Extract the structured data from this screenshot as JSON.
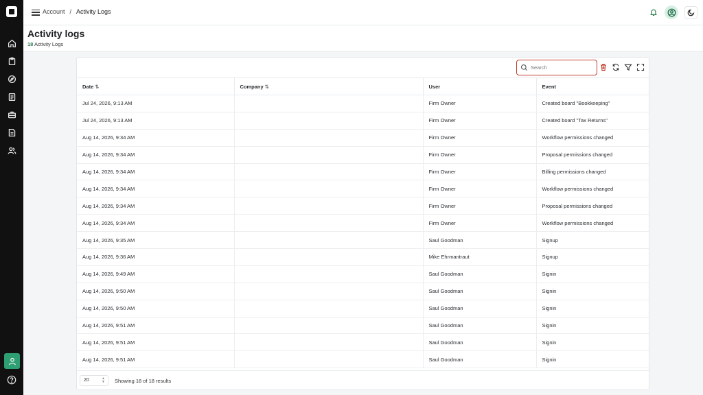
{
  "header": {
    "breadcrumb": [
      "Account",
      "Activity Logs"
    ],
    "breadcrumb_sep": "/"
  },
  "page": {
    "title": "Activity logs",
    "count": "18",
    "count_label": "Activity Logs"
  },
  "search": {
    "placeholder": "Search"
  },
  "table": {
    "columns": [
      "Date",
      "Company",
      "User",
      "Event"
    ],
    "sort_glyph": "⇅",
    "rows": [
      [
        "Jul 24, 2026, 9:13 AM",
        "",
        "Firm Owner",
        "Created board \"Bookkeeping\""
      ],
      [
        "Jul 24, 2026, 9:13 AM",
        "",
        "Firm Owner",
        "Created board \"Tax Returns\""
      ],
      [
        "Aug 14, 2026, 9:34 AM",
        "",
        "Firm Owner",
        "Workflow permissions changed"
      ],
      [
        "Aug 14, 2026, 9:34 AM",
        "",
        "Firm Owner",
        "Proposal permissions changed"
      ],
      [
        "Aug 14, 2026, 9:34 AM",
        "",
        "Firm Owner",
        "Billing permissions changed"
      ],
      [
        "Aug 14, 2026, 9:34 AM",
        "",
        "Firm Owner",
        "Workflow permissions changed"
      ],
      [
        "Aug 14, 2026, 9:34 AM",
        "",
        "Firm Owner",
        "Proposal permissions changed"
      ],
      [
        "Aug 14, 2026, 9:34 AM",
        "",
        "Firm Owner",
        "Workflow permissions changed"
      ],
      [
        "Aug 14, 2026, 9:35 AM",
        "",
        "Saul Goodman",
        "Signup"
      ],
      [
        "Aug 14, 2026, 9:36 AM",
        "",
        "Mike Ehrmantraut",
        "Signup"
      ],
      [
        "Aug 14, 2026, 9:49 AM",
        "",
        "Saul Goodman",
        "Signin"
      ],
      [
        "Aug 14, 2026, 9:50 AM",
        "",
        "Saul Goodman",
        "Signin"
      ],
      [
        "Aug 14, 2026, 9:50 AM",
        "",
        "Saul Goodman",
        "Signin"
      ],
      [
        "Aug 14, 2026, 9:51 AM",
        "",
        "Saul Goodman",
        "Signin"
      ],
      [
        "Aug 14, 2026, 9:51 AM",
        "",
        "Saul Goodman",
        "Signin"
      ],
      [
        "Aug 14, 2026, 9:51 AM",
        "",
        "Saul Goodman",
        "Signin"
      ]
    ]
  },
  "footer": {
    "page_size": "20",
    "results": "Showing 18 of 18 results"
  },
  "colors": {
    "accent": "#2e9e73",
    "danger": "#c0392b",
    "sidebar": "#111111"
  }
}
